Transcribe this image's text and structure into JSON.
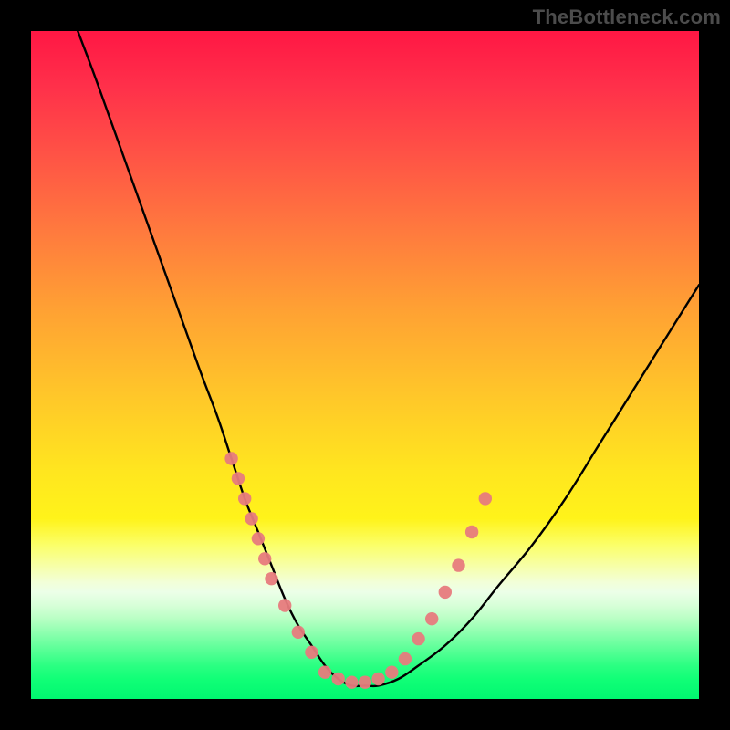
{
  "watermark": "TheBottleneck.com",
  "chart_data": {
    "type": "line",
    "title": "",
    "xlabel": "",
    "ylabel": "",
    "xlim": [
      0,
      100
    ],
    "ylim": [
      0,
      100
    ],
    "note": "Stylized bottleneck curve over a red→green vertical gradient. Y≈100 means full bottleneck (top/red), Y≈0 means no bottleneck (bottom/green). X is a relative hardware-balance axis with no visible tick labels.",
    "series": [
      {
        "name": "bottleneck-curve",
        "x": [
          7,
          10,
          15,
          20,
          25,
          28,
          30,
          32,
          34,
          36,
          38,
          40,
          42,
          44,
          46,
          48,
          50,
          52,
          55,
          58,
          62,
          66,
          70,
          75,
          80,
          85,
          90,
          95,
          100
        ],
        "y": [
          100,
          92,
          78,
          64,
          50,
          42,
          36,
          30,
          25,
          20,
          15,
          11,
          8,
          5,
          3,
          2,
          2,
          2,
          3,
          5,
          8,
          12,
          17,
          23,
          30,
          38,
          46,
          54,
          62
        ]
      }
    ],
    "markers": {
      "name": "highlight-dots",
      "color": "#e77b7d",
      "left_cluster": [
        [
          30,
          36
        ],
        [
          31,
          33
        ],
        [
          32,
          30
        ],
        [
          33,
          27
        ],
        [
          34,
          24
        ],
        [
          35,
          21
        ],
        [
          36,
          18
        ],
        [
          38,
          14
        ],
        [
          40,
          10
        ],
        [
          42,
          7
        ]
      ],
      "bottom_cluster": [
        [
          44,
          4
        ],
        [
          46,
          3
        ],
        [
          48,
          2.5
        ],
        [
          50,
          2.5
        ],
        [
          52,
          3
        ],
        [
          54,
          4
        ]
      ],
      "right_cluster": [
        [
          56,
          6
        ],
        [
          58,
          9
        ],
        [
          60,
          12
        ],
        [
          62,
          16
        ],
        [
          64,
          20
        ],
        [
          66,
          25
        ],
        [
          68,
          30
        ]
      ]
    },
    "gradient_stops": [
      {
        "pct": 0,
        "color": "#ff1744"
      },
      {
        "pct": 30,
        "color": "#ff7a3e"
      },
      {
        "pct": 55,
        "color": "#ffc829"
      },
      {
        "pct": 73,
        "color": "#fff31a"
      },
      {
        "pct": 84,
        "color": "#ecffe8"
      },
      {
        "pct": 100,
        "color": "#00f770"
      }
    ]
  }
}
